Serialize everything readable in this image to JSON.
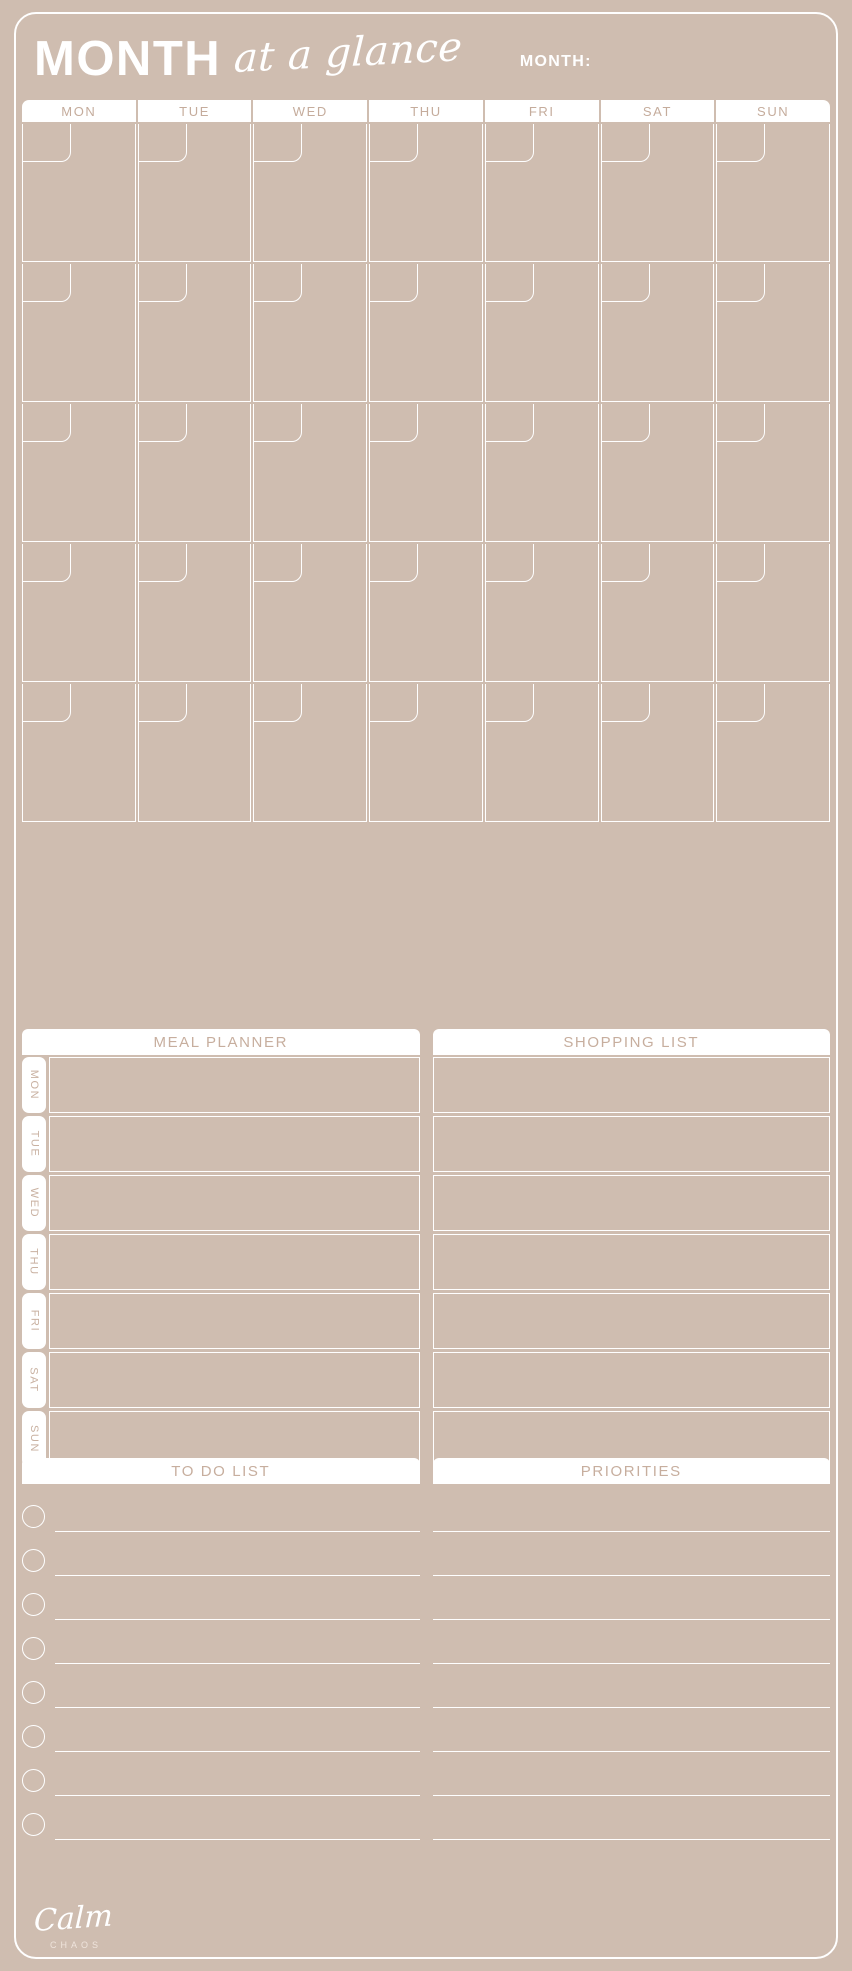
{
  "theme": {
    "background": "#cfbdb0",
    "line": "#ffffff",
    "panel": "#ffffff",
    "text_on_panel": "#c7ae9e",
    "title_text": "#ffffff"
  },
  "header": {
    "title_bold": "MONTH",
    "title_script": "at a glance",
    "month_label": "MONTH:"
  },
  "calendar": {
    "day_headers": [
      "MON",
      "TUE",
      "WED",
      "THU",
      "FRI",
      "SAT",
      "SUN"
    ],
    "weeks": 5,
    "columns": 7,
    "cells_blank": true
  },
  "meal_planner": {
    "title": "MEAL PLANNER",
    "days": [
      "MON",
      "TUE",
      "WED",
      "THU",
      "FRI",
      "SAT",
      "SUN"
    ],
    "entries": [
      "",
      "",
      "",
      "",
      "",
      "",
      ""
    ]
  },
  "shopping_list": {
    "title": "SHOPPING LIST",
    "rows": [
      "",
      "",
      "",
      "",
      "",
      "",
      ""
    ]
  },
  "todo_list": {
    "title": "TO DO LIST",
    "rows": [
      "",
      "",
      "",
      "",
      "",
      "",
      "",
      ""
    ]
  },
  "priorities": {
    "title": "PRIORITIES",
    "rows": [
      "",
      "",
      "",
      "",
      "",
      "",
      "",
      ""
    ]
  },
  "logo": {
    "script": "Calm",
    "subtitle": "CHAOS"
  }
}
